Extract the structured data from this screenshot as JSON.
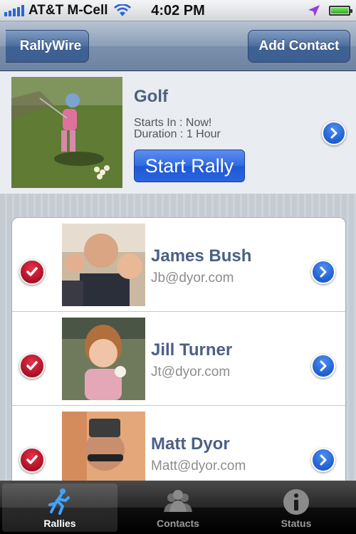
{
  "status_bar": {
    "carrier": "AT&T M-Cell",
    "time": "4:02 PM",
    "battery_level": 1.0
  },
  "nav": {
    "back_label": "RallyWire",
    "add_contact_label": "Add Contact"
  },
  "rally": {
    "title": "Golf",
    "starts_in": "Starts In : Now!",
    "duration": "Duration : 1 Hour",
    "start_button": "Start Rally"
  },
  "contacts": [
    {
      "name": "James Bush",
      "email": "Jb@dyor.com",
      "checked": true
    },
    {
      "name": "Jill Turner",
      "email": "Jt@dyor.com",
      "checked": true
    },
    {
      "name": "Matt Dyor",
      "email": "Matt@dyor.com",
      "checked": true
    }
  ],
  "tabs": [
    {
      "label": "Rallies",
      "icon": "runner-icon",
      "active": true
    },
    {
      "label": "Contacts",
      "icon": "people-icon",
      "active": false
    },
    {
      "label": "Status",
      "icon": "info-icon",
      "active": false
    }
  ],
  "colors": {
    "nav_blue": "#6d84a3",
    "title_blue": "#4c5f86",
    "check_red": "#c0142c",
    "disclosure_blue": "#1f5fd0"
  }
}
